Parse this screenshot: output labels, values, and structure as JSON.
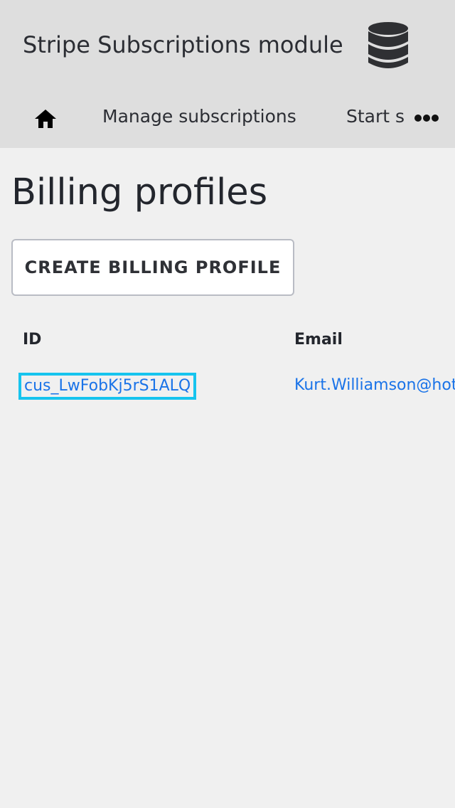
{
  "header": {
    "app_title": "Stripe Subscriptions module",
    "db_icon": "database-icon"
  },
  "nav": {
    "home_icon": "home-icon",
    "items": [
      {
        "label": "Manage subscriptions"
      },
      {
        "label": "Start subscription"
      }
    ],
    "more_icon": "more-horizontal-icon"
  },
  "main": {
    "title": "Billing profiles",
    "create_button_label": "CREATE BILLING PROFILE",
    "table": {
      "columns": [
        "ID",
        "Email"
      ],
      "rows": [
        {
          "id": "cus_LwFobKj5rS1ALQ",
          "email": "Kurt.Williamson@hotmail.com"
        }
      ]
    }
  },
  "colors": {
    "header_bg": "#dedede",
    "page_bg": "#f0f0f0",
    "link": "#1a73e8",
    "focus_ring": "#16c4ee"
  }
}
